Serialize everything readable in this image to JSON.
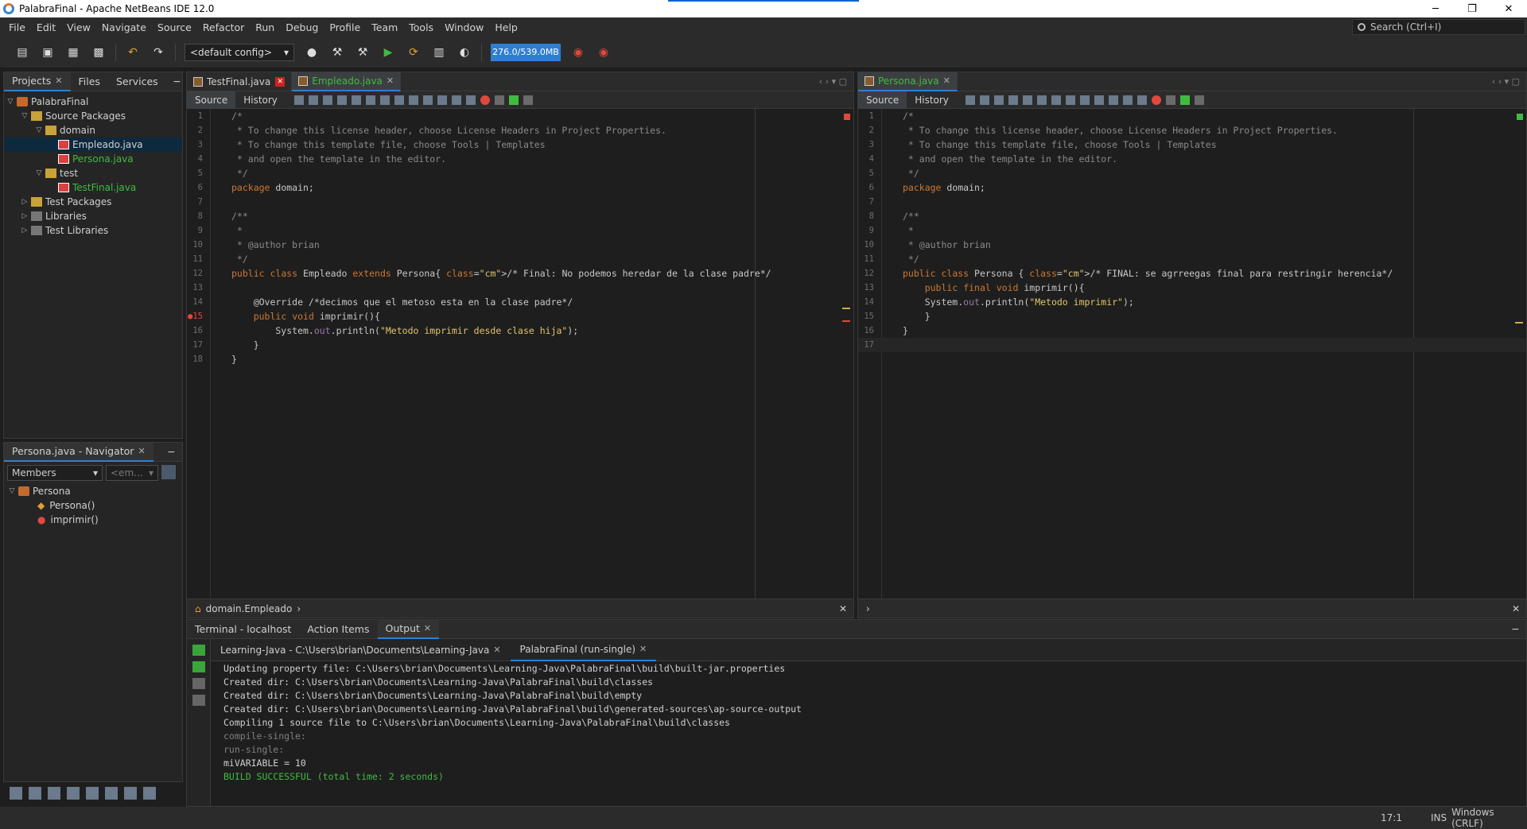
{
  "window": {
    "title": "PalabraFinal - Apache NetBeans IDE 12.0",
    "minimize": "─",
    "restore": "❐",
    "close": "✕"
  },
  "menu": [
    "File",
    "Edit",
    "View",
    "Navigate",
    "Source",
    "Refactor",
    "Run",
    "Debug",
    "Profile",
    "Team",
    "Tools",
    "Window",
    "Help"
  ],
  "search": {
    "placeholder": "Search (Ctrl+I)"
  },
  "toolbar": {
    "config": "<default config>",
    "memory": "276.0/539.0MB"
  },
  "projects_panel": {
    "tabs": [
      "Projects",
      "Files",
      "Services"
    ],
    "tree": [
      {
        "label": "PalabraFinal",
        "level": 0,
        "icon": "project"
      },
      {
        "label": "Source Packages",
        "level": 1,
        "icon": "package"
      },
      {
        "label": "domain",
        "level": 2,
        "icon": "package"
      },
      {
        "label": "Empleado.java",
        "level": 3,
        "icon": "java",
        "selected": true
      },
      {
        "label": "Persona.java",
        "level": 3,
        "icon": "java",
        "green": true
      },
      {
        "label": "test",
        "level": 2,
        "icon": "package"
      },
      {
        "label": "TestFinal.java",
        "level": 3,
        "icon": "java",
        "green": true
      },
      {
        "label": "Test Packages",
        "level": 1,
        "icon": "package"
      },
      {
        "label": "Libraries",
        "level": 1,
        "icon": "lib"
      },
      {
        "label": "Test Libraries",
        "level": 1,
        "icon": "lib"
      }
    ]
  },
  "navigator": {
    "title": "Persona.java - Navigator",
    "members": "Members",
    "filter": "<em...",
    "tree": [
      {
        "label": "Persona",
        "level": 0
      },
      {
        "label": "Persona()",
        "level": 1
      },
      {
        "label": "imprimir()",
        "level": 1
      }
    ]
  },
  "left_editor": {
    "tabs": [
      {
        "label": "TestFinal.java"
      },
      {
        "label": "Empleado.java",
        "active": true
      }
    ],
    "source": "Source",
    "history": "History",
    "breadcrumb": "domain.Empleado",
    "lines": [
      "/*",
      " * To change this license header, choose License Headers in Project Properties.",
      " * To change this template file, choose Tools | Templates",
      " * and open the template in the editor.",
      " */",
      "package domain;",
      "",
      "/**",
      " *",
      " * @author brian",
      " */",
      "public class Empleado extends Persona{ /* Final: No podemos heredar de la clase padre*/",
      "",
      "    @Override /*decimos que el metoso esta en la clase padre*/",
      "    public void imprimir(){",
      "        System.out.println(\"Metodo imprimir desde clase hija\");",
      "    }",
      "}"
    ]
  },
  "right_editor": {
    "tabs": [
      {
        "label": "Persona.java",
        "active": true
      }
    ],
    "source": "Source",
    "history": "History",
    "lines": [
      "/*",
      " * To change this license header, choose License Headers in Project Properties.",
      " * To change this template file, choose Tools | Templates",
      " * and open the template in the editor.",
      " */",
      "package domain;",
      "",
      "/**",
      " *",
      " * @author brian",
      " */",
      "public class Persona { /* FINAL: se agrreegas final para restringir herencia*/",
      "    public final void imprimir(){",
      "    System.out.println(\"Metodo imprimir\");",
      "    }",
      "}",
      ""
    ]
  },
  "output": {
    "tabs": [
      {
        "label": "Terminal - localhost"
      },
      {
        "label": "Action Items"
      },
      {
        "label": "Output",
        "active": true
      }
    ],
    "subtabs": [
      {
        "label": "Learning-Java - C:\\Users\\brian\\Documents\\Learning-Java"
      },
      {
        "label": "PalabraFinal (run-single)",
        "active": true
      }
    ],
    "lines": [
      "Updating property file: C:\\Users\\brian\\Documents\\Learning-Java\\PalabraFinal\\build\\built-jar.properties",
      "Created dir: C:\\Users\\brian\\Documents\\Learning-Java\\PalabraFinal\\build\\classes",
      "Created dir: C:\\Users\\brian\\Documents\\Learning-Java\\PalabraFinal\\build\\empty",
      "Created dir: C:\\Users\\brian\\Documents\\Learning-Java\\PalabraFinal\\build\\generated-sources\\ap-source-output",
      "Compiling 1 source file to C:\\Users\\brian\\Documents\\Learning-Java\\PalabraFinal\\build\\classes",
      "compile-single:",
      "run-single:",
      "miVARIABLE = 10",
      "BUILD SUCCESSFUL (total time: 2 seconds)"
    ]
  },
  "status": {
    "position": "17:1",
    "mode": "INS",
    "line_ending": "Windows (CRLF)"
  },
  "colors": {
    "accent": "#2f7fd1",
    "error": "#e0483e",
    "success": "#3fbc3f"
  }
}
